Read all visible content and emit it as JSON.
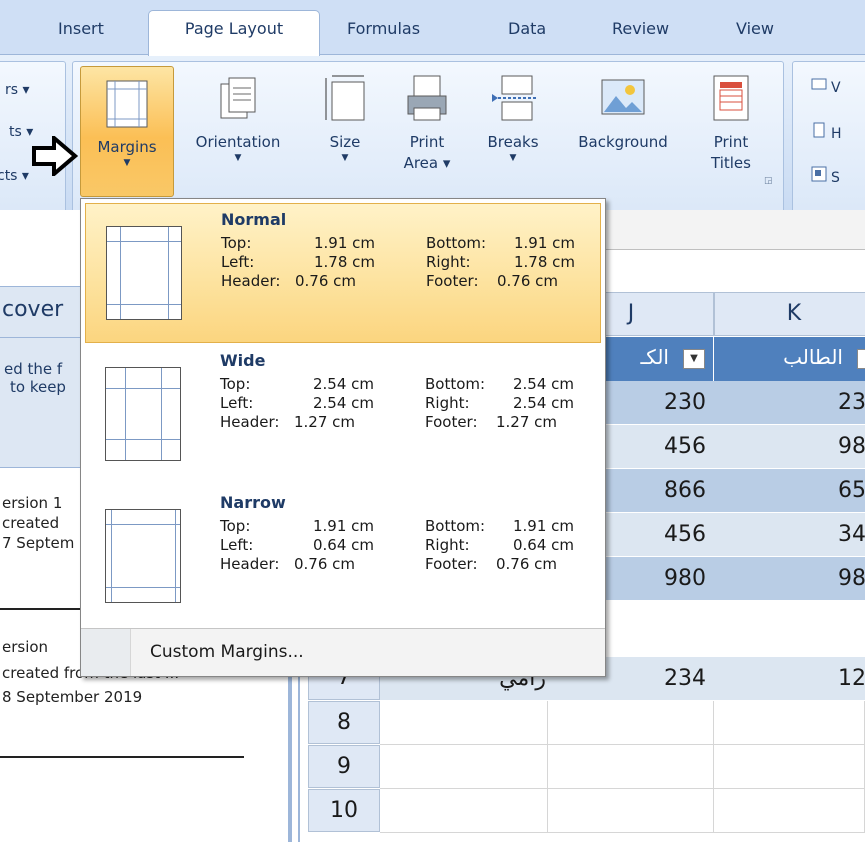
{
  "tabs": {
    "insert": "Insert",
    "page_layout": "Page Layout",
    "formulas": "Formulas",
    "data": "Data",
    "review": "Review",
    "view": "View"
  },
  "ribbon": {
    "left_group": {
      "r1": "rs ▾",
      "r2": "ts ▾",
      "r3": "cts ▾"
    },
    "margins": "Margins",
    "orientation": "Orientation",
    "size": "Size",
    "print_area_1": "Print",
    "print_area_2": "Area ▾",
    "breaks": "Breaks",
    "background": "Background",
    "print_titles_1": "Print",
    "print_titles_2": "Titles",
    "right_group": {
      "r1": "V",
      "r2": "H",
      "r3": "S"
    }
  },
  "margins_menu": {
    "options": [
      {
        "name": "Normal",
        "top": "1.91 cm",
        "bottom": "1.91 cm",
        "left": "1.78 cm",
        "right": "1.78 cm",
        "header": "0.76 cm",
        "footer": "0.76 cm"
      },
      {
        "name": "Wide",
        "top": "2.54 cm",
        "bottom": "2.54 cm",
        "left": "2.54 cm",
        "right": "2.54 cm",
        "header": "1.27 cm",
        "footer": "1.27 cm"
      },
      {
        "name": "Narrow",
        "top": "1.91 cm",
        "bottom": "1.91 cm",
        "left": "0.64 cm",
        "right": "0.64 cm",
        "header": "0.76 cm",
        "footer": "0.76 cm"
      }
    ],
    "labels": {
      "top": "Top:",
      "bottom": "Bottom:",
      "left": "Left:",
      "right": "Right:",
      "header": "Header:",
      "footer": "Footer:"
    },
    "custom": "Custom Margins..."
  },
  "left_panel": {
    "title": "cover",
    "desc1": "ed the f",
    "desc2": "to keep",
    "v1_line1": "ersion 1",
    "v1_line2": "created",
    "v1_line3": "7 Septem",
    "v2_line1": "ersion",
    "v2_line2": "created from the last ...",
    "v2_line3": "8 September 2019"
  },
  "sheet": {
    "col_j": "J",
    "col_k": "K",
    "header_j": "الكـ",
    "header_k": "الطالب",
    "j_values": [
      "230",
      "456",
      "866",
      "456",
      "980",
      "234"
    ],
    "k_values": [
      "23",
      "98",
      "65",
      "34",
      "98",
      "12"
    ],
    "row7_name": "رامي",
    "row_numbers": [
      "7",
      "8",
      "9",
      "10"
    ]
  }
}
